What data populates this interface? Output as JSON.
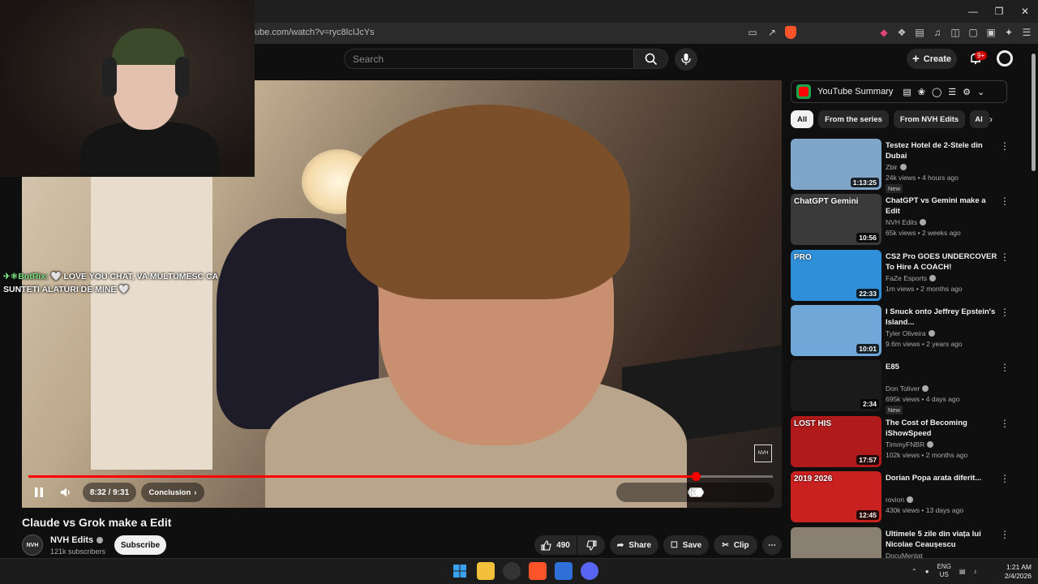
{
  "browser": {
    "url": "ube.com/watch?v=ryc8lcIJcYs",
    "window_controls": [
      "minimize",
      "restore",
      "close"
    ]
  },
  "header": {
    "search_placeholder": "Search",
    "create_label": "Create",
    "notifications_badge": "9+"
  },
  "player": {
    "current_time": "8:32",
    "duration": "9:31",
    "time_display": "8:32 / 9:31",
    "chapter": "Conclusion",
    "progress_fraction": 0.896,
    "chat_user": "BotRix:",
    "chat_message": "🤍 LOVE YOU CHAT, VA MULTUMESC CA SUNTETI ALATURI DE MINE 🤍",
    "watermark": "NVH"
  },
  "video": {
    "title": "Claude vs Grok make a Edit",
    "channel": "NVH Edits",
    "channel_initials": "NVH",
    "subscribers": "121k subscribers",
    "subscribe_label": "Subscribe",
    "likes": "490",
    "share_label": "Share",
    "save_label": "Save",
    "clip_label": "Clip"
  },
  "sidebar": {
    "extension_title": "YouTube Summary",
    "chips": [
      "All",
      "From the series",
      "From NVH Edits",
      "Al"
    ],
    "recommendations": [
      {
        "title": "Testez Hotel de 2-Stele din Dubai",
        "channel": "Zbir",
        "meta": "24k views • 4 hours ago",
        "duration": "1:13:25",
        "badge": "New",
        "thumb_color": "#7fa6c9",
        "thumb_text": ""
      },
      {
        "title": "ChatGPT vs Gemini make a Edit",
        "channel": "NVH Edits",
        "meta": "65k views • 2 weeks ago",
        "duration": "10:56",
        "badge": "",
        "thumb_color": "#3a3a3a",
        "thumb_text": "ChatGPT  Gemini"
      },
      {
        "title": "CS2 Pro GOES UNDERCOVER To Hire A COACH!",
        "channel": "FaZe Esports",
        "meta": "1m views • 2 months ago",
        "duration": "22:33",
        "badge": "",
        "thumb_color": "#2f8fd8",
        "thumb_text": "PRO"
      },
      {
        "title": "I Snuck onto Jeffrey Epstein's Island...",
        "channel": "Tyler Oliveira",
        "meta": "9.6m views • 2 years ago",
        "duration": "10:01",
        "badge": "",
        "thumb_color": "#6fa8d8",
        "thumb_text": ""
      },
      {
        "title": "E85",
        "channel": "Don Toliver",
        "meta": "695k views • 4 days ago",
        "duration": "2:34",
        "badge": "New",
        "thumb_color": "#1a1a1a",
        "thumb_text": ""
      },
      {
        "title": "The Cost of Becoming iShowSpeed",
        "channel": "TimmyFNBR",
        "meta": "102k views • 2 months ago",
        "duration": "17:57",
        "badge": "",
        "thumb_color": "#b11a1a",
        "thumb_text": "LOST HIS"
      },
      {
        "title": "Dorian Popa arata diferit...",
        "channel": "rovion",
        "meta": "430k views • 13 days ago",
        "duration": "12:45",
        "badge": "",
        "thumb_color": "#c92020",
        "thumb_text": "2019  2026"
      },
      {
        "title": "Ultimele 5 zile din viața lui Nicolae Ceaușescu",
        "channel": "DocuMentat",
        "meta": "",
        "duration": "",
        "badge": "",
        "thumb_color": "#8a8072",
        "thumb_text": ""
      }
    ]
  },
  "taskbar": {
    "lang_top": "ENG",
    "lang_bottom": "US",
    "time": "1:21 AM",
    "date": "2/4/2026"
  },
  "colors": {
    "accent_red": "#ff0000",
    "background": "#0f0f0f"
  }
}
